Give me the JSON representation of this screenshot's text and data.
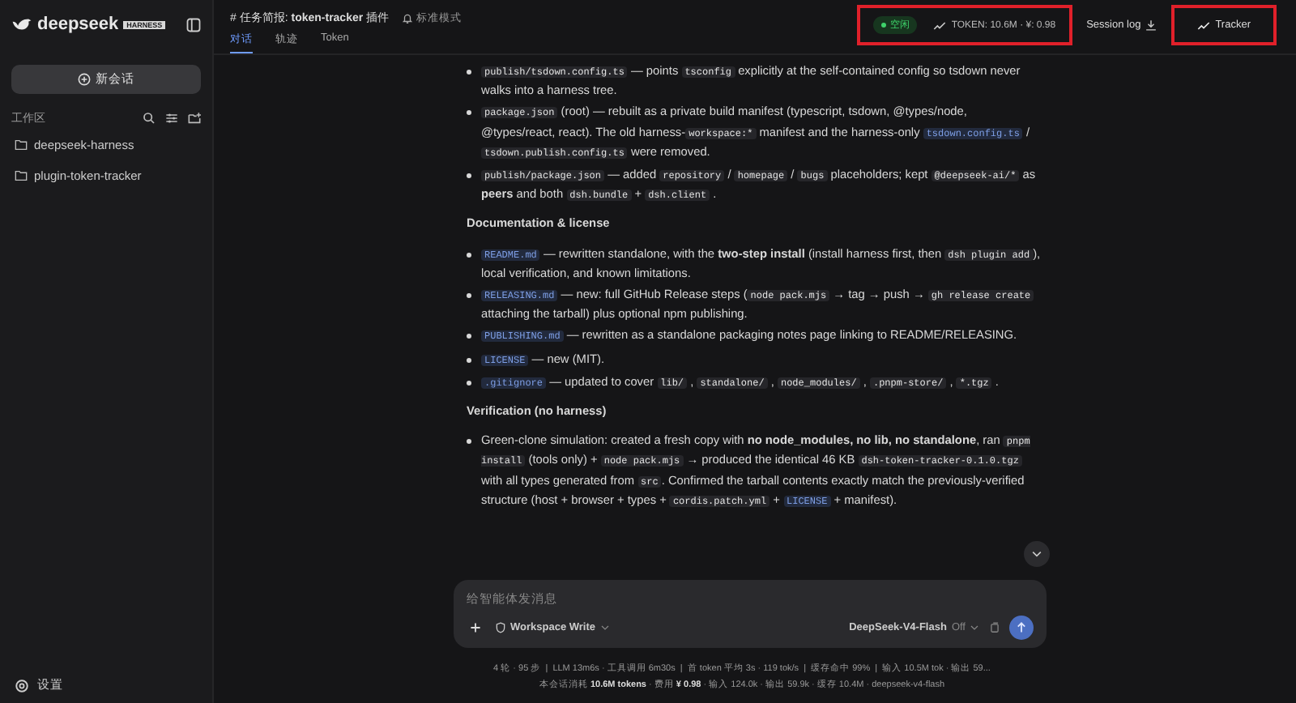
{
  "sidebar": {
    "logo": "deepseek",
    "logo_badge": "HARNESS",
    "new_chat": "新会话",
    "workspace_label": "工作区",
    "folders": [
      {
        "name": "deepseek-harness",
        "selected": false
      },
      {
        "name": "plugin-token-tracker",
        "selected": false
      }
    ],
    "settings": "设置"
  },
  "header": {
    "title": "# 任务简报: **token-tracker** 插件",
    "mode": "标准模式",
    "tabs": [
      {
        "label": "对话",
        "selected": true
      },
      {
        "label": "轨迹",
        "selected": false
      },
      {
        "label": "Token",
        "selected": false
      }
    ],
    "status": "空闲",
    "token_summary": "TOKEN: 10.6M · ¥: 0.98",
    "session_log": "Session log",
    "tracker": "Tracker"
  },
  "content": [
    {
      "kind": "bullet",
      "parts": [
        {
          "kind": "code",
          "text": "publish/tsdown.config.ts"
        },
        {
          "kind": "text",
          "text": " — points "
        },
        {
          "kind": "code",
          "text": "tsconfig"
        },
        {
          "kind": "text",
          "text": " explicitly at the self-contained config so tsdown never walks into a harness tree."
        }
      ]
    },
    {
      "kind": "bullet",
      "parts": [
        {
          "kind": "code",
          "text": "package.json"
        },
        {
          "kind": "text",
          "text": " (root) — rebuilt as a private build manifest (typescript, tsdown, @types/node, @types/react, react). The old harness-"
        },
        {
          "kind": "code",
          "text": "workspace:*"
        },
        {
          "kind": "text",
          "text": " manifest and the harness-only "
        },
        {
          "kind": "path",
          "text": "tsdown.config.ts"
        },
        {
          "kind": "text",
          "text": " / "
        },
        {
          "kind": "code",
          "text": "tsdown.publish.config.ts"
        },
        {
          "kind": "text",
          "text": " were removed."
        }
      ]
    },
    {
      "kind": "bullet",
      "parts": [
        {
          "kind": "code",
          "text": "publish/package.json"
        },
        {
          "kind": "text",
          "text": " — added "
        },
        {
          "kind": "code",
          "text": "repository"
        },
        {
          "kind": "text",
          "text": " / "
        },
        {
          "kind": "code",
          "text": "homepage"
        },
        {
          "kind": "text",
          "text": " / "
        },
        {
          "kind": "code",
          "text": "bugs"
        },
        {
          "kind": "text",
          "text": " placeholders; kept "
        },
        {
          "kind": "code",
          "text": "@deepseek-ai/*"
        },
        {
          "kind": "text",
          "text": " as **peers** and both "
        },
        {
          "kind": "code",
          "text": "dsh.bundle"
        },
        {
          "kind": "text",
          "text": " + "
        },
        {
          "kind": "code",
          "text": "dsh.client"
        },
        {
          "kind": "text",
          "text": " ."
        }
      ]
    },
    {
      "kind": "heading",
      "text": "Documentation & license"
    },
    {
      "kind": "bullet",
      "parts": [
        {
          "kind": "path",
          "text": "README.md"
        },
        {
          "kind": "text",
          "text": " — rewritten standalone, with the **two-step install** (install harness first, then "
        },
        {
          "kind": "code",
          "text": "dsh plugin add"
        },
        {
          "kind": "text",
          "text": "), local verification, and known limitations."
        }
      ]
    },
    {
      "kind": "bullet",
      "parts": [
        {
          "kind": "path",
          "text": "RELEASING.md"
        },
        {
          "kind": "text",
          "text": " — new: full GitHub Release steps ("
        },
        {
          "kind": "code",
          "text": "node pack.mjs"
        },
        {
          "kind": "text",
          "text": " → tag → push → "
        },
        {
          "kind": "code",
          "text": "gh release create"
        },
        {
          "kind": "text",
          "text": " attaching the tarball) plus optional npm publishing."
        }
      ]
    },
    {
      "kind": "bullet",
      "parts": [
        {
          "kind": "path",
          "text": "PUBLISHING.md"
        },
        {
          "kind": "text",
          "text": " — rewritten as a standalone packaging notes page linking to README/RELEASING."
        }
      ]
    },
    {
      "kind": "bullet",
      "parts": [
        {
          "kind": "path",
          "text": "LICENSE"
        },
        {
          "kind": "text",
          "text": " — new (MIT)."
        }
      ]
    },
    {
      "kind": "bullet",
      "parts": [
        {
          "kind": "path",
          "text": ".gitignore"
        },
        {
          "kind": "text",
          "text": " — updated to cover "
        },
        {
          "kind": "code",
          "text": "lib/"
        },
        {
          "kind": "text",
          "text": " , "
        },
        {
          "kind": "code",
          "text": "standalone/"
        },
        {
          "kind": "text",
          "text": " , "
        },
        {
          "kind": "code",
          "text": "node_modules/"
        },
        {
          "kind": "text",
          "text": " , "
        },
        {
          "kind": "code",
          "text": ".pnpm-store/"
        },
        {
          "kind": "text",
          "text": " , "
        },
        {
          "kind": "code",
          "text": "*.tgz"
        },
        {
          "kind": "text",
          "text": " ."
        }
      ]
    },
    {
      "kind": "heading",
      "text": "Verification (no harness)"
    },
    {
      "kind": "bullet",
      "parts": [
        {
          "kind": "text",
          "text": "Green-clone simulation: created a fresh copy with **no node_modules, no lib, no standalone**, ran "
        },
        {
          "kind": "code",
          "text": "pnpm install"
        },
        {
          "kind": "text",
          "text": " (tools only) + "
        },
        {
          "kind": "code",
          "text": "node pack.mjs"
        },
        {
          "kind": "text",
          "text": " → produced the identical 46 KB "
        },
        {
          "kind": "code",
          "text": "dsh-token-tracker-0.1.0.tgz"
        },
        {
          "kind": "text",
          "text": " with all types generated from "
        },
        {
          "kind": "code",
          "text": "src"
        },
        {
          "kind": "text",
          "text": ". Confirmed the tarball contents exactly match the previously-verified structure (host + browser + types + "
        },
        {
          "kind": "code",
          "text": "cordis.patch.yml"
        },
        {
          "kind": "text",
          "text": " + "
        },
        {
          "kind": "path",
          "text": "LICENSE"
        },
        {
          "kind": "text",
          "text": " + manifest)."
        }
      ]
    }
  ],
  "composer": {
    "placeholder": "给智能体发消息",
    "permission": "Workspace Write",
    "model": "DeepSeek-V4-Flash",
    "thinking": "Off"
  },
  "footer": {
    "stats": "4 轮 · 95 步  |  LLM 13m6s · 工具调用 6m30s  |  首 token 平均 3s · 119 tok/s  |  缓存命中 99%  |  输入 10.5M tok · 输出 59...",
    "usage": "本会话消耗 **10.6M tokens** · 费用 **¥ 0.98** · 输入 124.0k · 输出 59.9k · 缓存 10.4M · deepseek-v4-flash"
  }
}
